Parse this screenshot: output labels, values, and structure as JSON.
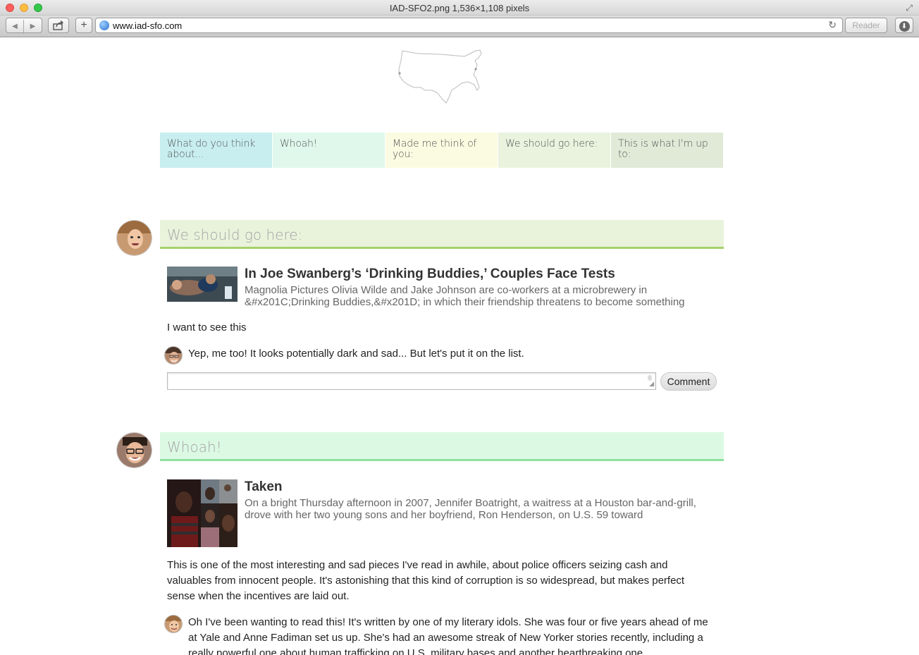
{
  "window": {
    "title": "IAD-SFO2.png 1,536×1,108 pixels"
  },
  "toolbar": {
    "back_icon": "back-icon",
    "forward_icon": "forward-icon",
    "share_icon": "share-icon",
    "new_tab_label": "+",
    "url": "www.iad-sfo.com",
    "reader_label": "Reader",
    "download_icon": "download-icon"
  },
  "nav": {
    "tabs": [
      {
        "label": "What do you think about...",
        "color": "#c8eef0"
      },
      {
        "label": "Whoah!",
        "color": "#e0f8ec"
      },
      {
        "label": "Made me think of you:",
        "color": "#fbfbe1"
      },
      {
        "label": "We should go here:",
        "color": "#e9f3de"
      },
      {
        "label": "This is what I'm up to:",
        "color": "#e1ead7"
      }
    ]
  },
  "posts": [
    {
      "header": "We should go here:",
      "header_bg": "#e9f3dc",
      "header_border": "#a5d16b",
      "article_title": "In Joe Swanberg’s ‘Drinking Buddies,’ Couples Face Tests",
      "article_snippet": "Magnolia Pictures Olivia Wilde and Jake Johnson are co-workers at a microbrewery in &#x201C;Drinking Buddies,&#x201D; in which their friendship threatens to become something",
      "body": "I want to see this",
      "comments": [
        {
          "text": "Yep, me too! It looks potentially dark and sad... But let's put it on the list."
        }
      ],
      "comment_button": "Comment"
    },
    {
      "header": "Whoah!",
      "header_bg": "#dcf9e4",
      "header_border": "#8ee09e",
      "article_title": "Taken",
      "article_snippet": "On a bright Thursday afternoon in 2007, Jennifer Boatright, a waitress at a Houston bar-and-grill, drove with her two young sons and her boyfriend, Ron Henderson, on U.S. 59 toward",
      "body": "This is one of the most interesting and sad pieces I've read in awhile, about police officers seizing cash and valuables from innocent people. It's astonishing that this kind of corruption is so widespread, but makes perfect sense when the incentives are laid out.",
      "comments": [
        {
          "text": "Oh I've been wanting to read this! It's written by one of my literary idols. She was four or five years ahead of me at Yale and Anne Fadiman set us up. She's had an awesome streak of New Yorker stories recently, including a really powerful one about human trafficking on U.S. military bases and another heartbreaking one"
        }
      ]
    }
  ]
}
